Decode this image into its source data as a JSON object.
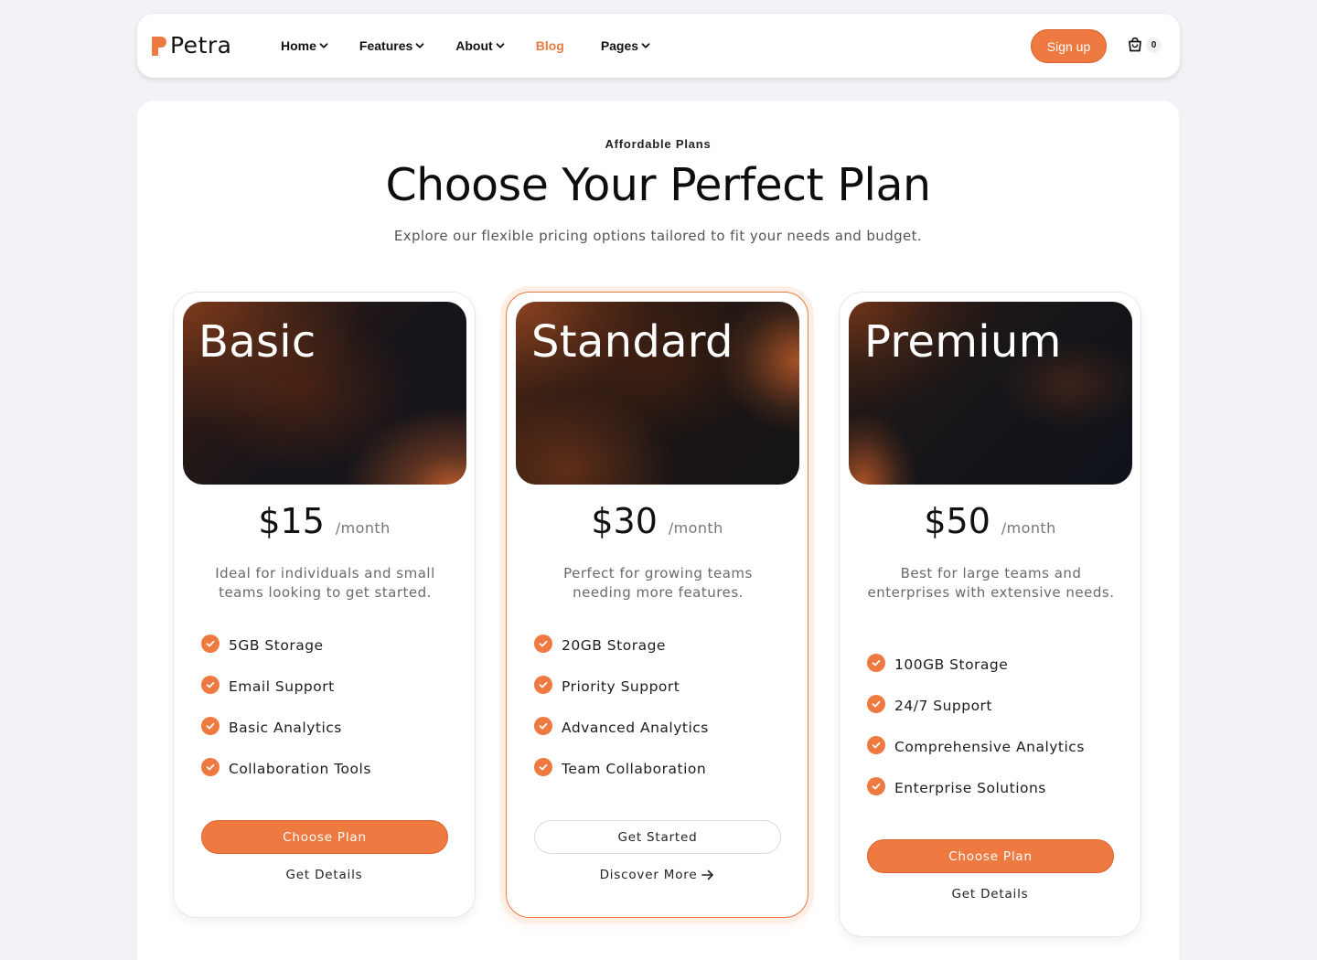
{
  "brand": {
    "name": "Petra"
  },
  "nav": {
    "items": [
      {
        "label": "Home",
        "has_dropdown": true
      },
      {
        "label": "Features",
        "has_dropdown": true
      },
      {
        "label": "About",
        "has_dropdown": true
      },
      {
        "label": "Blog",
        "has_dropdown": false,
        "active": true
      },
      {
        "label": "Pages",
        "has_dropdown": true
      }
    ],
    "signup_label": "Sign up",
    "cart_count": "0"
  },
  "colors": {
    "accent": "#ef7a41",
    "background": "#f3f2f7"
  },
  "section": {
    "eyebrow": "Affordable Plans",
    "title": "Choose Your Perfect Plan",
    "subtitle": "Explore our flexible pricing options tailored to fit your needs and budget."
  },
  "plans": [
    {
      "name": "Basic",
      "price": "$15",
      "period": "/month",
      "description": "Ideal for individuals and small teams looking to get started.",
      "features": [
        "5GB Storage",
        "Email Support",
        "Basic Analytics",
        "Collaboration Tools"
      ],
      "primary_label": "Choose Plan",
      "secondary_label": "Get Details"
    },
    {
      "name": "Standard",
      "price": "$30",
      "period": "/month",
      "description": "Perfect for growing teams needing more features.",
      "features": [
        "20GB Storage",
        "Priority Support",
        "Advanced Analytics",
        "Team Collaboration"
      ],
      "primary_label": "Get Started",
      "secondary_label": "Discover More",
      "featured": true
    },
    {
      "name": "Premium",
      "price": "$50",
      "period": "/month",
      "description": "Best for large teams and enterprises with extensive needs.",
      "features": [
        "100GB Storage",
        "24/7 Support",
        "Comprehensive Analytics",
        "Enterprise Solutions"
      ],
      "primary_label": "Choose Plan",
      "secondary_label": "Get Details"
    }
  ]
}
